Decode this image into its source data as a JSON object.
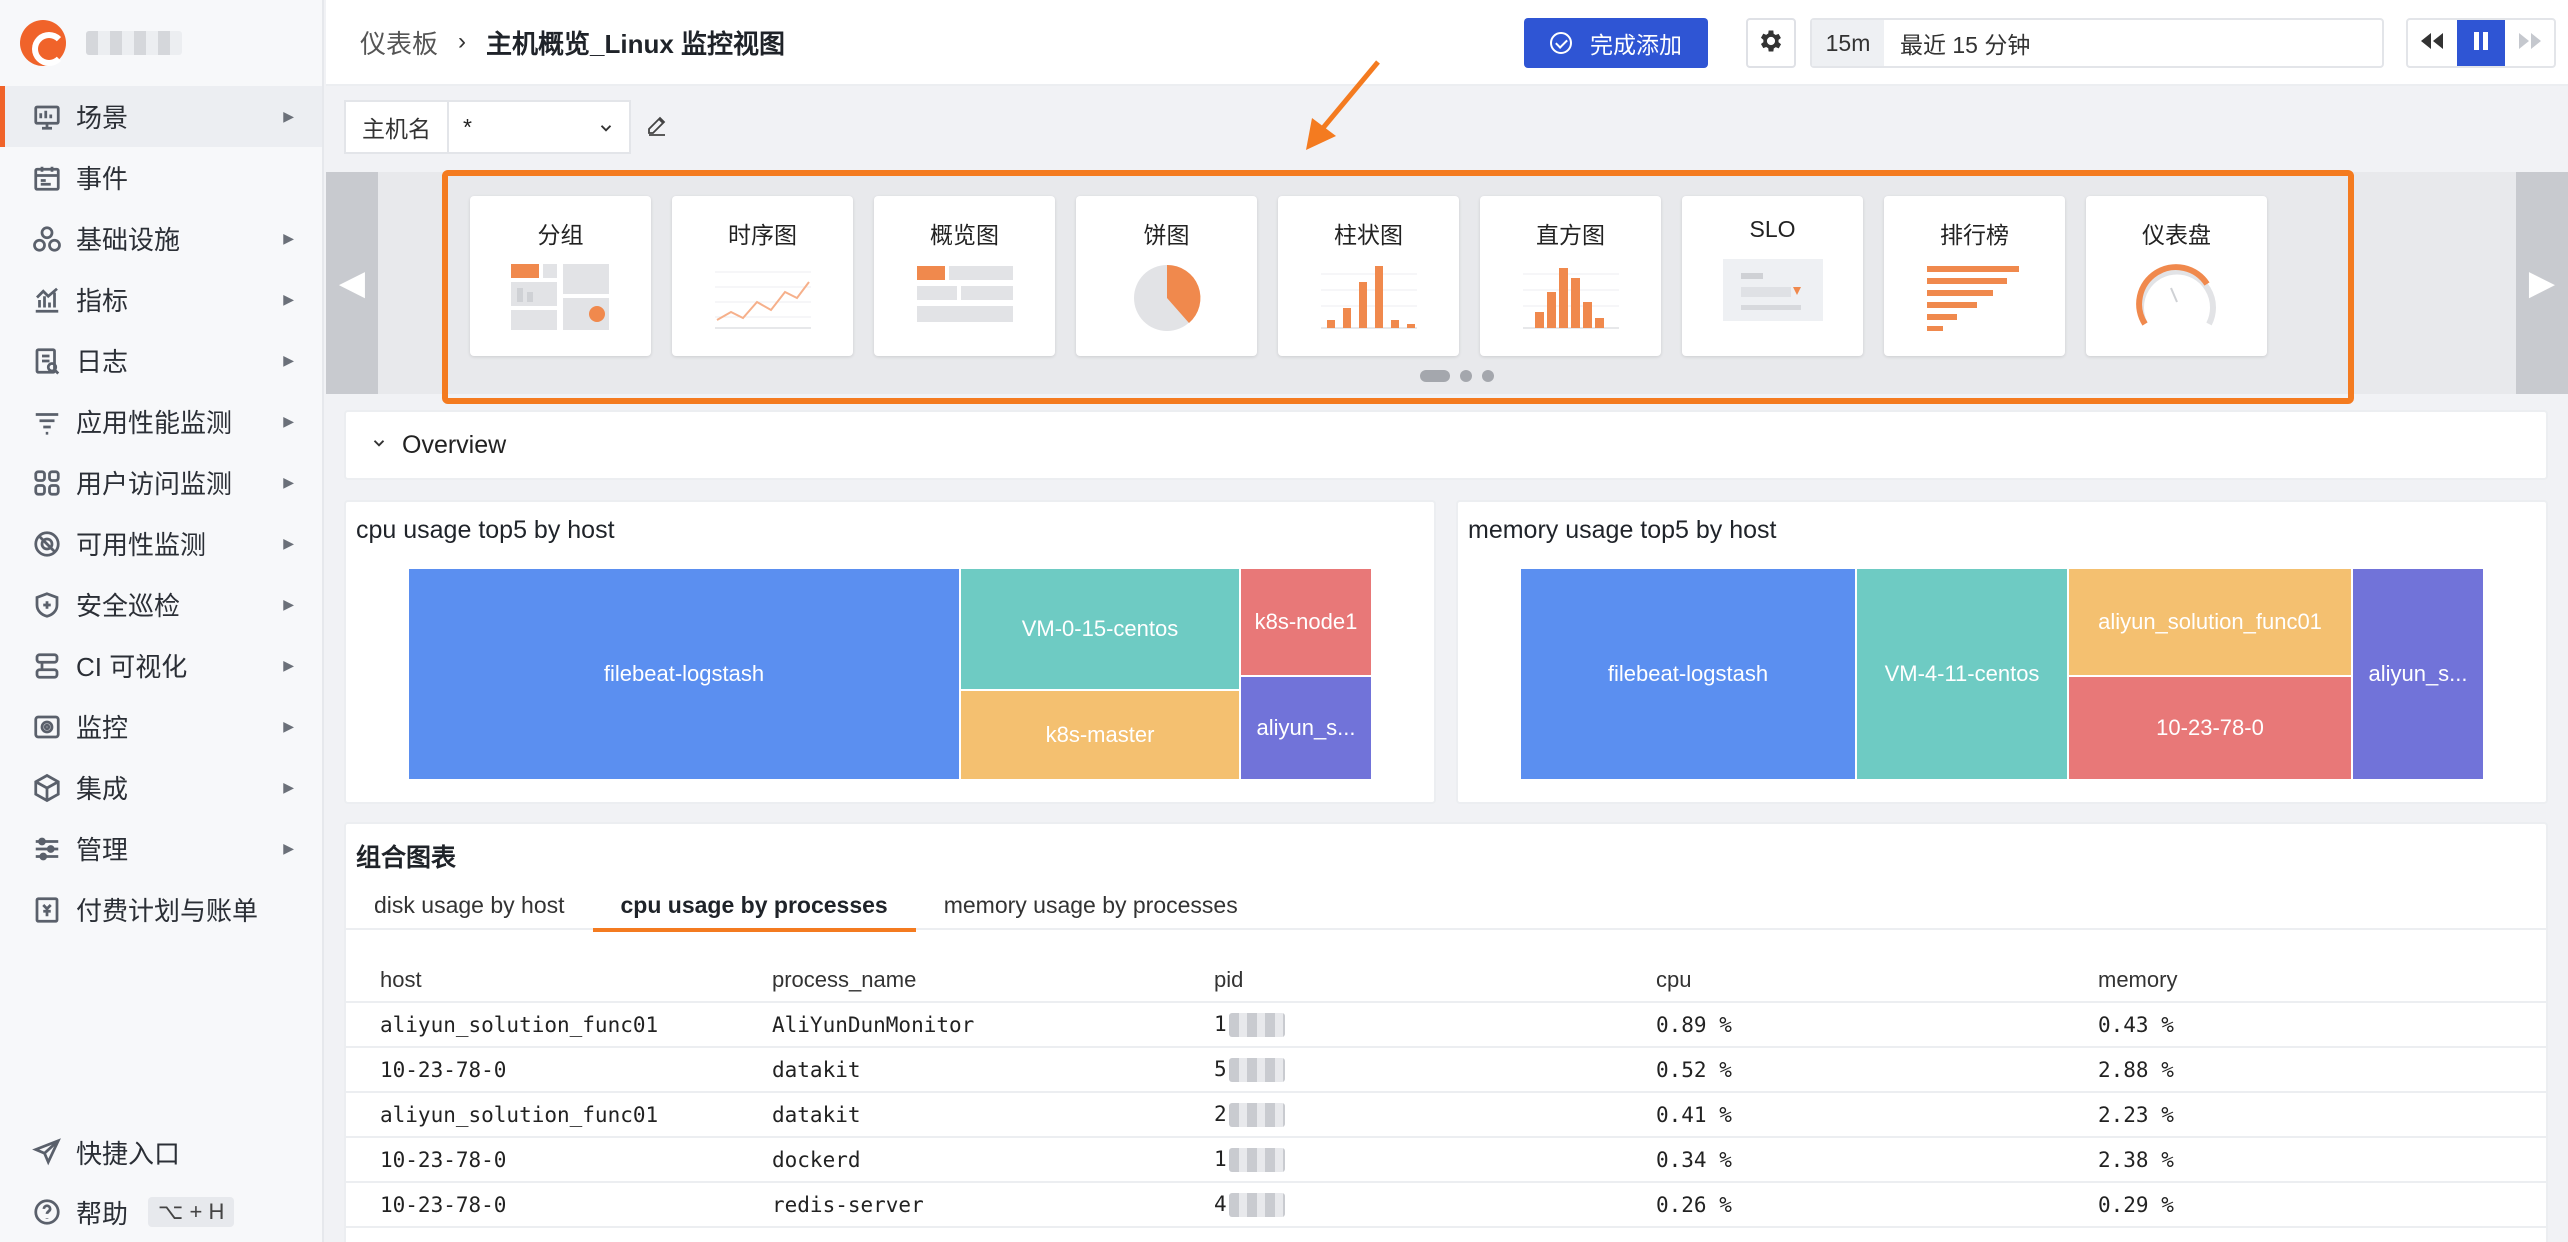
{
  "sidebar": {
    "items": [
      {
        "label": "场景",
        "icon": "scene-icon",
        "active": true
      },
      {
        "label": "事件",
        "icon": "event-icon"
      },
      {
        "label": "基础设施",
        "icon": "infrastructure-icon"
      },
      {
        "label": "指标",
        "icon": "metrics-icon"
      },
      {
        "label": "日志",
        "icon": "log-icon"
      },
      {
        "label": "应用性能监测",
        "icon": "apm-icon"
      },
      {
        "label": "用户访问监测",
        "icon": "rum-icon"
      },
      {
        "label": "可用性监测",
        "icon": "availability-icon"
      },
      {
        "label": "安全巡检",
        "icon": "security-icon"
      },
      {
        "label": "CI 可视化",
        "icon": "ci-icon"
      },
      {
        "label": "监控",
        "icon": "monitor-icon"
      },
      {
        "label": "集成",
        "icon": "integration-icon"
      },
      {
        "label": "管理",
        "icon": "manage-icon"
      },
      {
        "label": "付费计划与账单",
        "icon": "billing-icon"
      }
    ],
    "bottom": {
      "shortcut": "快捷入口",
      "help": "帮助",
      "help_kbd": "⌥ + H"
    }
  },
  "header": {
    "breadcrumb_root": "仪表板",
    "breadcrumb_sep": "›",
    "breadcrumb_current": "主机概览_Linux 监控视图",
    "done_button": "完成添加",
    "time_short": "15m",
    "time_long": "最近 15 分钟"
  },
  "filter": {
    "label": "主机名",
    "value": "*"
  },
  "chart_types": [
    {
      "label": "分组",
      "thumb": "group"
    },
    {
      "label": "时序图",
      "thumb": "timeseries"
    },
    {
      "label": "概览图",
      "thumb": "overview"
    },
    {
      "label": "饼图",
      "thumb": "pie"
    },
    {
      "label": "柱状图",
      "thumb": "bar"
    },
    {
      "label": "直方图",
      "thumb": "histogram"
    },
    {
      "label": "SLO",
      "thumb": "slo"
    },
    {
      "label": "排行榜",
      "thumb": "toplist"
    },
    {
      "label": "仪表盘",
      "thumb": "gauge"
    }
  ],
  "overview": {
    "title": "Overview"
  },
  "cpu_treemap": {
    "title": "cpu usage top5 by host",
    "cells": [
      {
        "label": "filebeat-logstash",
        "color": "#5b8ff0"
      },
      {
        "label": "VM-0-15-centos",
        "color": "#6ecbc3"
      },
      {
        "label": "k8s-master",
        "color": "#f4c070"
      },
      {
        "label": "k8s-node1",
        "color": "#e87878"
      },
      {
        "label": "aliyun_s...",
        "color": "#7173d9"
      }
    ]
  },
  "mem_treemap": {
    "title": "memory usage top5 by host",
    "cells": [
      {
        "label": "filebeat-logstash",
        "color": "#5b8ff0"
      },
      {
        "label": "VM-4-11-centos",
        "color": "#6ecbc3"
      },
      {
        "label": "aliyun_solution_func01",
        "color": "#f4c070"
      },
      {
        "label": "10-23-78-0",
        "color": "#e87878"
      },
      {
        "label": "aliyun_s...",
        "color": "#7173d9"
      }
    ]
  },
  "combo": {
    "title": "组合图表",
    "tabs": [
      {
        "label": "disk usage by host",
        "active": false
      },
      {
        "label": "cpu usage by processes",
        "active": true
      },
      {
        "label": "memory usage by processes",
        "active": false
      }
    ],
    "columns": [
      "host",
      "process_name",
      "pid",
      "cpu",
      "memory"
    ],
    "rows": [
      {
        "host": "aliyun_solution_func01",
        "process_name": "AliYunDunMonitor",
        "pid": "1",
        "cpu": "0.89 %",
        "memory": "0.43 %"
      },
      {
        "host": "10-23-78-0",
        "process_name": "datakit",
        "pid": "5",
        "cpu": "0.52 %",
        "memory": "2.88 %"
      },
      {
        "host": "aliyun_solution_func01",
        "process_name": "datakit",
        "pid": "2",
        "cpu": "0.41 %",
        "memory": "2.23 %"
      },
      {
        "host": "10-23-78-0",
        "process_name": "dockerd",
        "pid": "1",
        "cpu": "0.34 %",
        "memory": "2.38 %"
      },
      {
        "host": "10-23-78-0",
        "process_name": "redis-server",
        "pid": "4",
        "cpu": "0.26 %",
        "memory": "0.29 %"
      }
    ]
  },
  "colors": {
    "accent": "#f47b20",
    "primary": "#2f55d4"
  }
}
